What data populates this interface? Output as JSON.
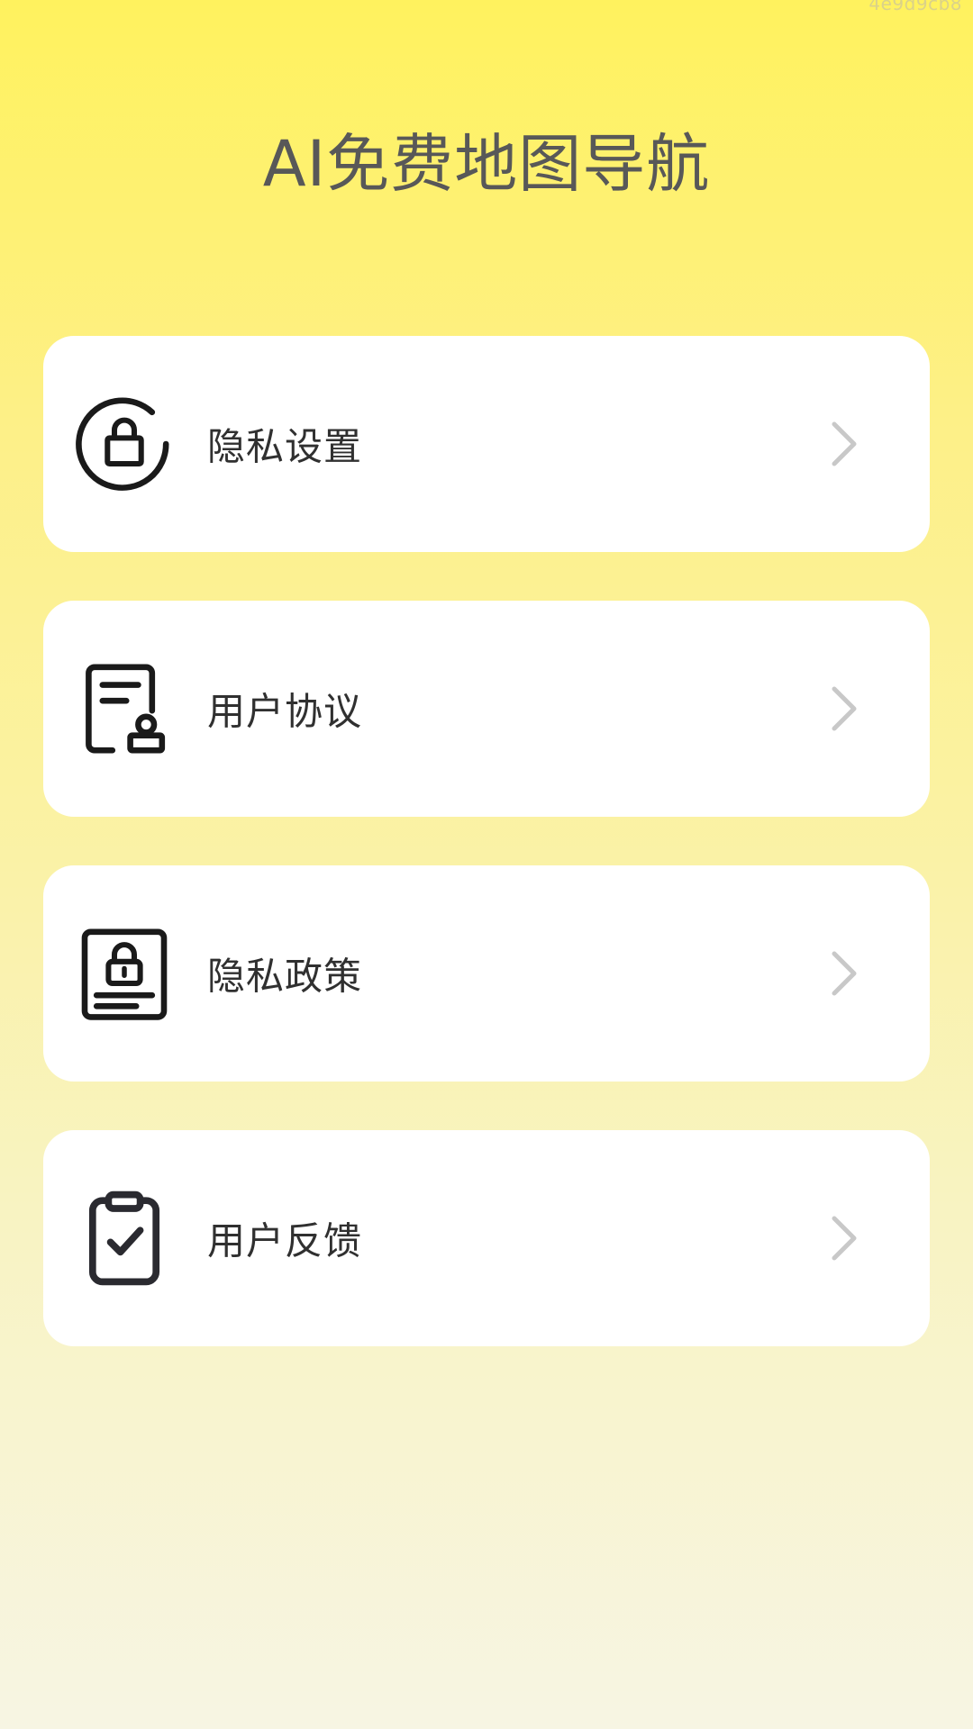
{
  "watermark": "4e9d9cb8",
  "header": {
    "title": "AI免费地图导航"
  },
  "menu": {
    "items": [
      {
        "label": "隐私设置",
        "icon": "lock-refresh-icon"
      },
      {
        "label": "用户协议",
        "icon": "document-seal-icon"
      },
      {
        "label": "隐私政策",
        "icon": "privacy-policy-icon"
      },
      {
        "label": "用户反馈",
        "icon": "clipboard-check-icon"
      }
    ]
  },
  "colors": {
    "background_top": "#fff25e",
    "background_bottom": "#f7f5e3",
    "card": "#ffffff",
    "title_text": "#585858",
    "item_text": "#303030",
    "chevron": "#c8c8c8"
  }
}
